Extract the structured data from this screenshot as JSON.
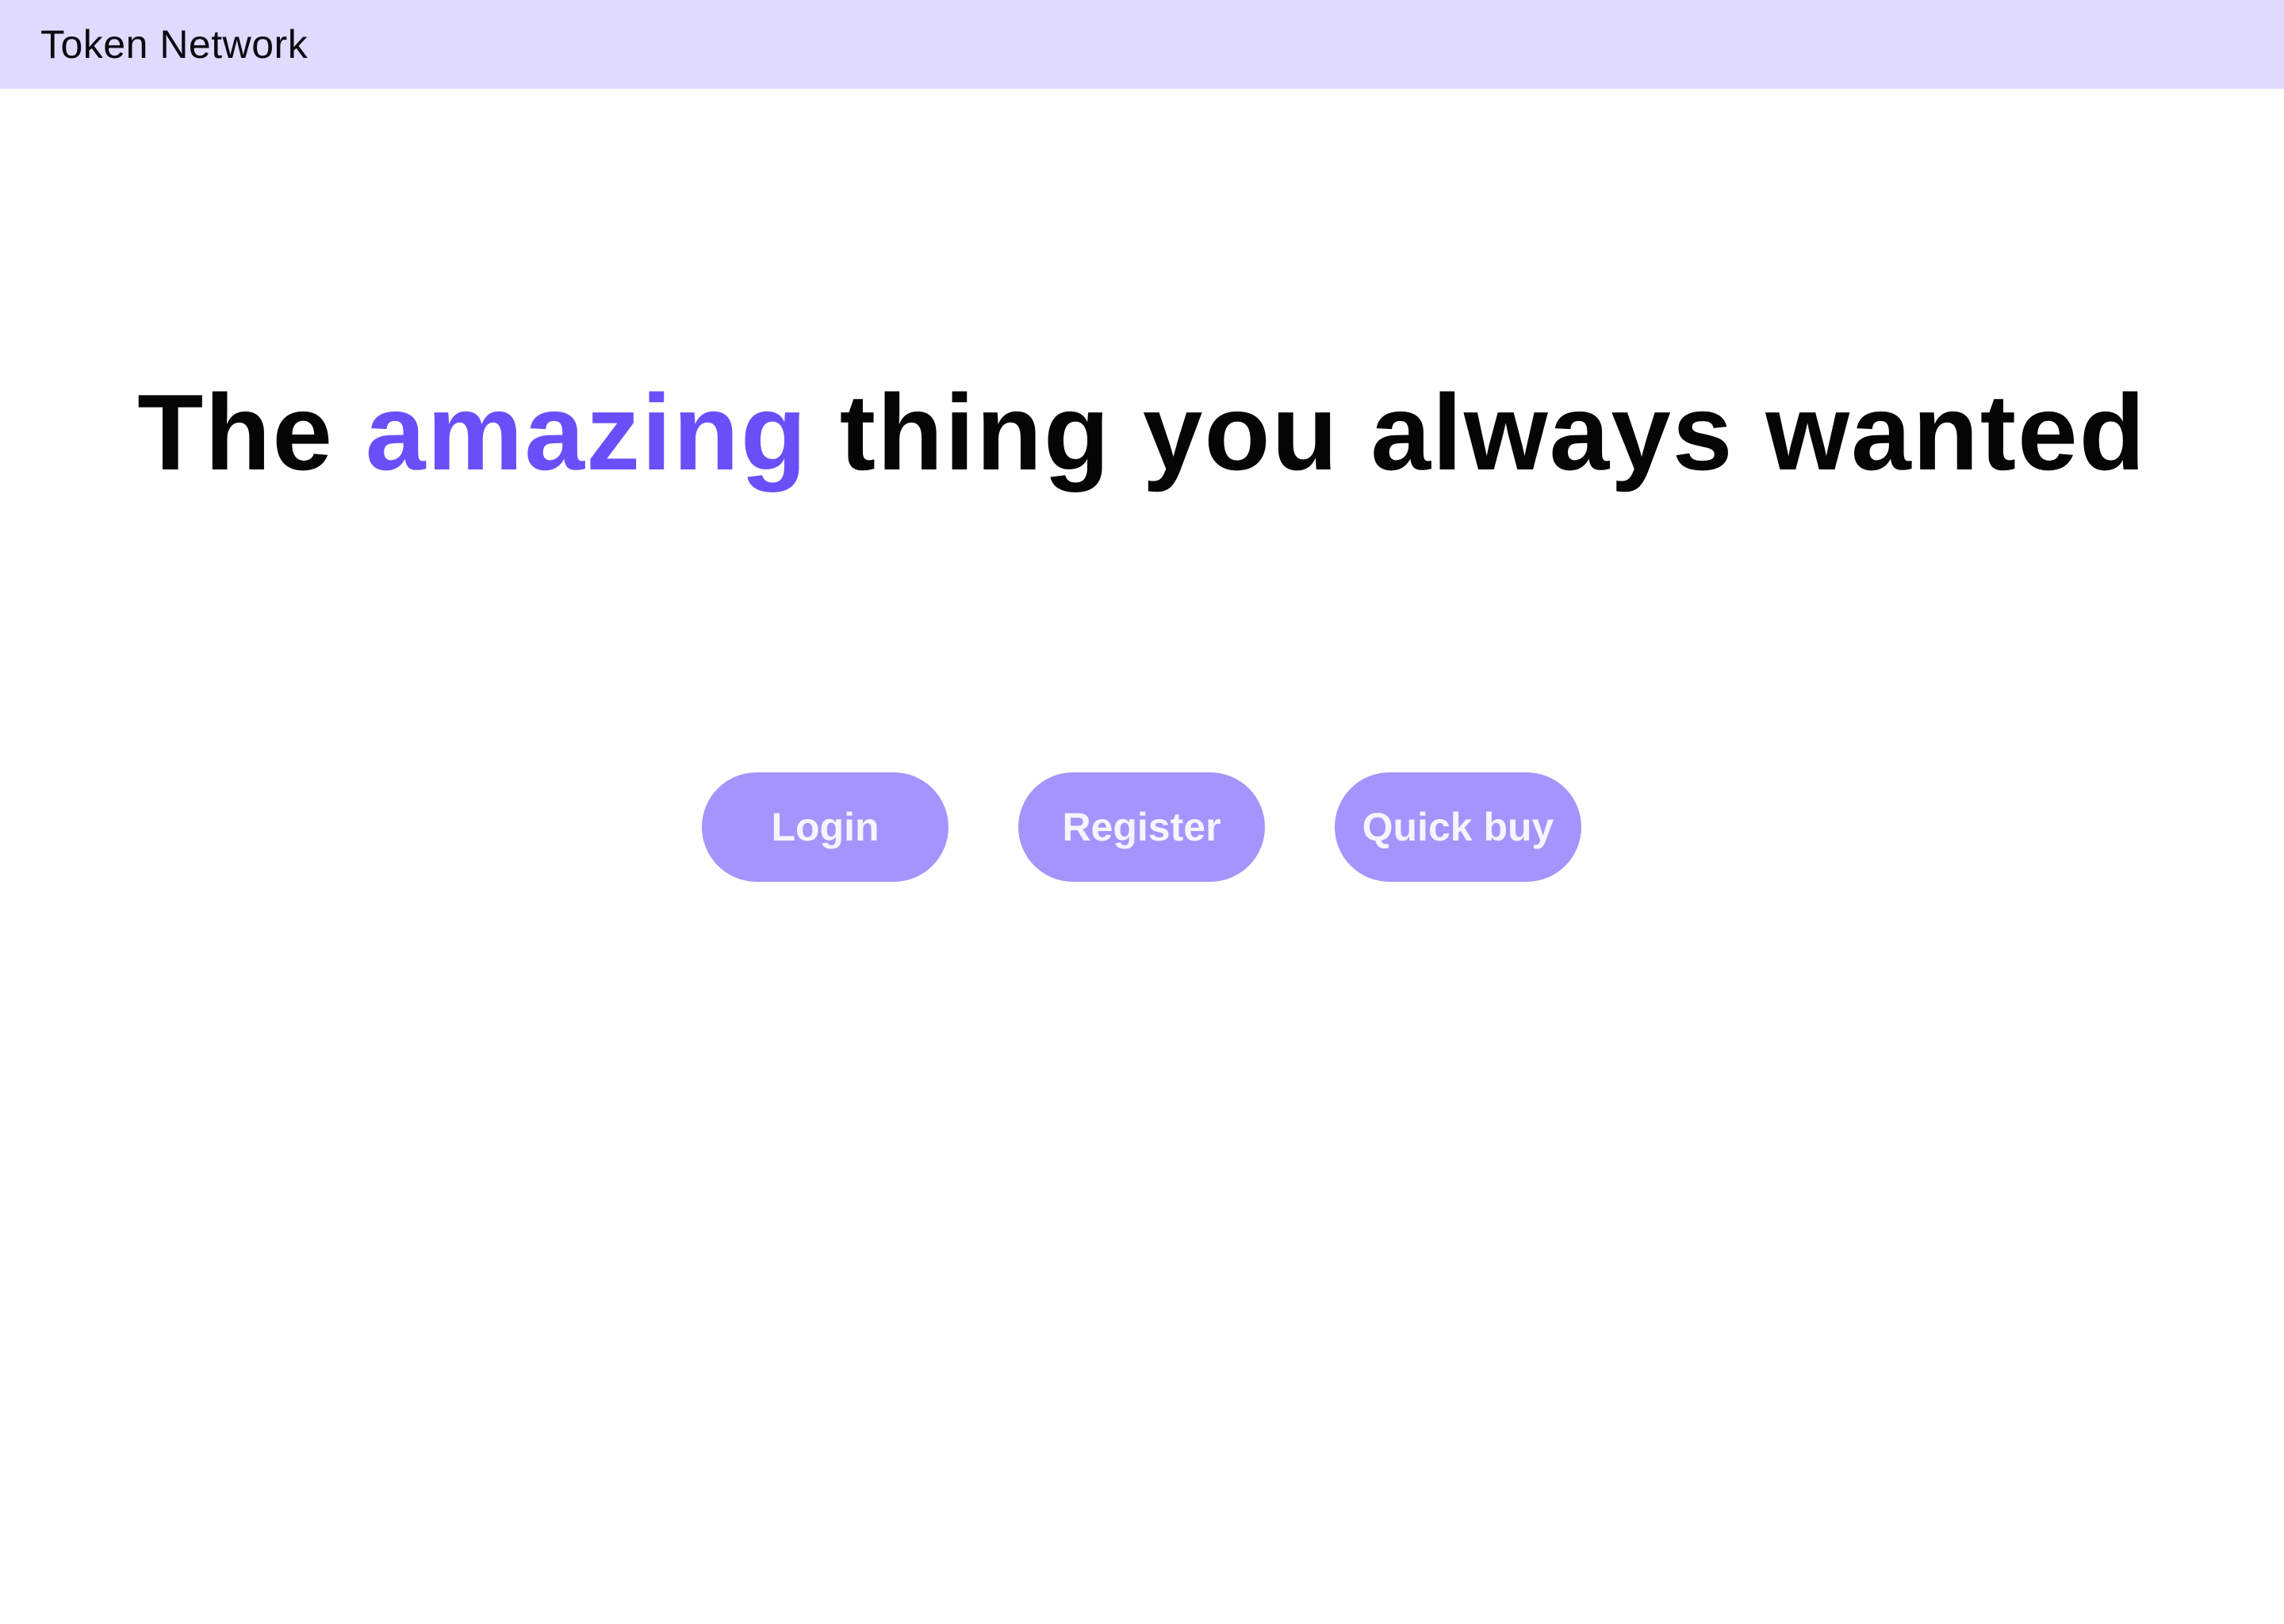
{
  "header": {
    "brand": "Token Network"
  },
  "hero": {
    "prefix": "The ",
    "highlight": "amazing",
    "suffix": " thing you always wanted"
  },
  "actions": {
    "login_label": "Login",
    "register_label": "Register",
    "quick_buy_label": "Quick buy"
  },
  "colors": {
    "header_bg": "#e0dafe",
    "accent": "#6a4ff8",
    "button_bg": "#a594fb",
    "button_text": "#f6f4ff",
    "heading_text": "#050505"
  }
}
